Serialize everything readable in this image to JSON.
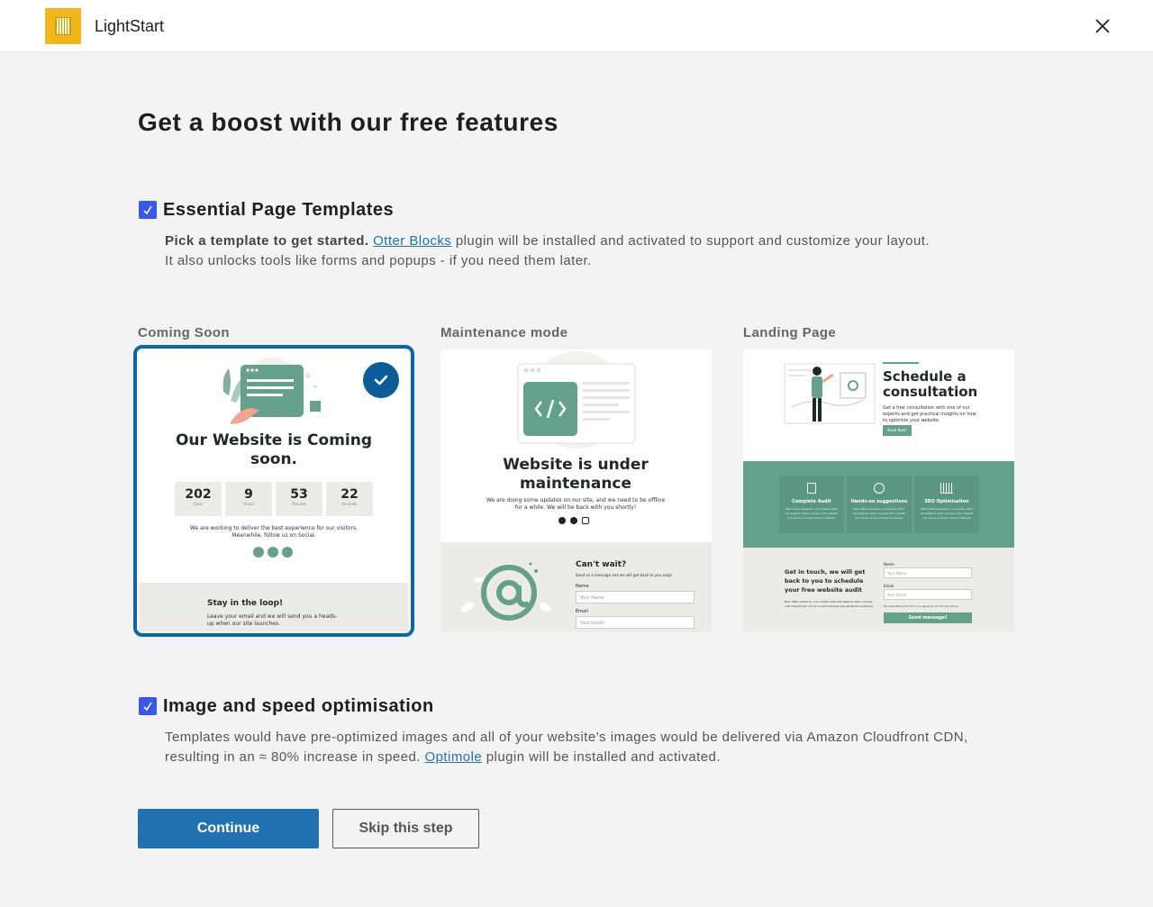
{
  "header": {
    "app_name": "LightStart"
  },
  "page": {
    "title": "Get a boost with our free features"
  },
  "templates_section": {
    "title": "Essential Page Templates",
    "checked": true,
    "desc_bold": "Pick a template to get started.",
    "link_text": "Otter Blocks",
    "desc_rest": " plugin will be installed and activated to support and customize your layout.",
    "desc_line2": "It also unlocks tools like forms and popups - if you need them later."
  },
  "templates": [
    {
      "label": "Coming Soon",
      "selected": true,
      "heading": "Our Website is Coming soon.",
      "countdown": [
        {
          "value": "202",
          "unit": "Days"
        },
        {
          "value": "9",
          "unit": "Hours"
        },
        {
          "value": "53",
          "unit": "Minutes"
        },
        {
          "value": "22",
          "unit": "Seconds"
        }
      ],
      "body": "We are working to deliver the best experience for our visitors. Meanwhile, follow us on Social.",
      "footer_title": "Stay in the loop!",
      "footer_text": "Leave your email and we will send you a heads-up when our site launches."
    },
    {
      "label": "Maintenance mode",
      "selected": false,
      "heading": "Website is under maintenance",
      "body": "We are doing some updates on our site, and we need to be offline for a while. We will be back with you shortly!",
      "footer_title": "Can't wait?",
      "footer_text": "Send us a message and we will get back to you asap!",
      "name_label": "Name",
      "name_placeholder": "Your Name",
      "email_label": "Email",
      "email_placeholder": "Your email"
    },
    {
      "label": "Landing Page",
      "selected": false,
      "heading": "Schedule a consultation",
      "intro": "Get a free consultation with one of our experts and get practical insights on how to optimize your website.",
      "cta": "Book Now!",
      "features": [
        "Complete Audit",
        "Hands-on suggestions",
        "SEO Optimisation"
      ],
      "feature_text": "Nam libero tempore, cum soluta nobis est eligendi optio cumque nihil impedit quo minus id quod maxime placeat.",
      "contact_title": "Get in touch, we will get back to you to schedule your free website audit",
      "contact_text": "Nam libero tempore, cum soluta nobis est eligendi optio cumque nihil impedit quo minus id quod maxime placeat facere possimus.",
      "name_label": "Name",
      "name_placeholder": "Your Name",
      "email_label": "Email",
      "email_placeholder": "Your email",
      "consent": "By submitting this form you agree to our Privacy Policy.",
      "send": "Send message!"
    }
  ],
  "optimisation_section": {
    "title": "Image and speed optimisation",
    "checked": true,
    "desc_line1": "Templates would have pre-optimized images and all of your website’s images would be delivered via Amazon Cloudfront CDN,",
    "desc_line2_pre": "resulting in an ≈ 80% increase in speed. ",
    "link_text": "Optimole",
    "desc_line2_post": " plugin will be installed and activated."
  },
  "actions": {
    "continue": "Continue",
    "skip": "Skip this step"
  },
  "colors": {
    "accent": "#2271b1",
    "checkbox": "#3858e9",
    "template_green": "#64a18a",
    "selected_outline": "#0b67a4",
    "logo": "#f0b71b"
  }
}
